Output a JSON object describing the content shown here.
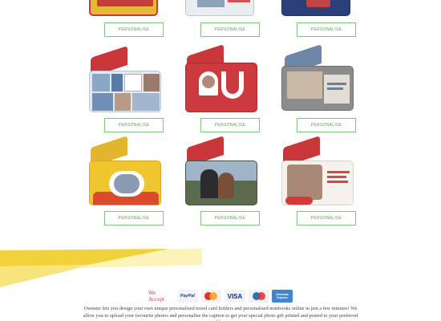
{
  "products": [
    {
      "id": "top-left",
      "button": "PERSONALISE",
      "style": "yellow-red",
      "caption": ""
    },
    {
      "id": "top-mid",
      "button": "PERSONALISE",
      "style": "white-photo",
      "caption": ""
    },
    {
      "id": "top-right",
      "button": "PERSONALISE",
      "style": "navy-red",
      "caption": ""
    },
    {
      "id": "collage",
      "button": "PERSONALISE",
      "style": "collage",
      "caption": ""
    },
    {
      "id": "heart-you",
      "button": "PERSONALISE",
      "style": "red-you",
      "caption": ""
    },
    {
      "id": "love-you",
      "button": "PERSONALISE",
      "style": "grey-love",
      "caption": ""
    },
    {
      "id": "yellow-hearts",
      "button": "PERSONALISE",
      "style": "yellow-hearts",
      "caption": ""
    },
    {
      "id": "couple-photo",
      "button": "PERSONALISE",
      "style": "couple",
      "caption": ""
    },
    {
      "id": "valentine",
      "button": "PERSONALISE",
      "style": "white-red",
      "caption": ""
    }
  ],
  "payments": {
    "label": "We Accept",
    "methods": [
      "PayPal",
      "Mastercard",
      "VISA",
      "Maestro",
      "American Express"
    ]
  },
  "about_text": "Ownster lets you design your own unique personalised travel card holders and personalised notebooks online in just a few minutes! We allow you to upload your favourite photos and personalise the caption to get your special photo gift printed and posted to your preferred address.",
  "colors": {
    "button_border": "#7cc67c",
    "button_text": "#55a455",
    "band_yellow": "#f2d23a",
    "band_pale": "#fbf3b8",
    "accept_text": "#c24040"
  }
}
